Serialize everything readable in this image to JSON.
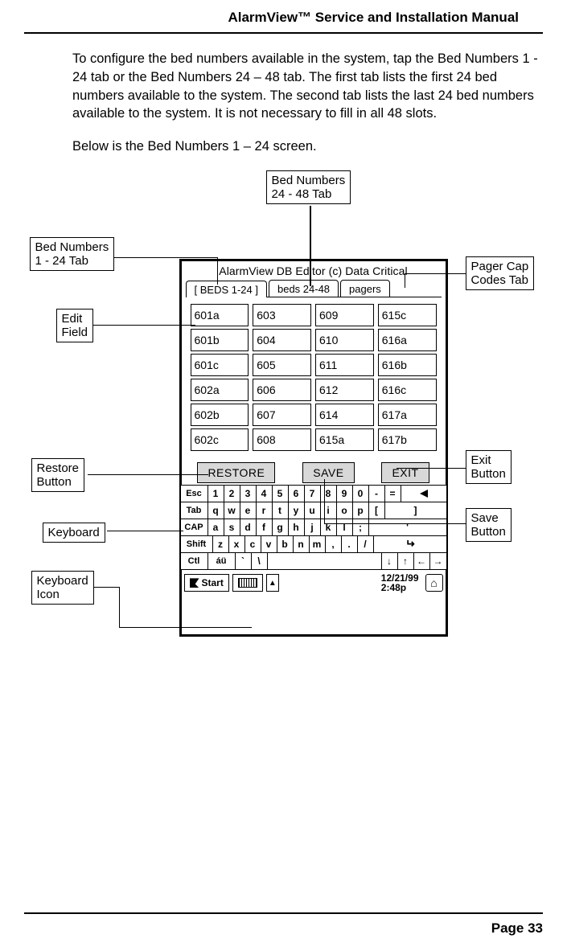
{
  "header": {
    "title": "AlarmView™ Service and Installation Manual"
  },
  "text": {
    "p1": "To configure the bed numbers available in the system, tap the Bed Numbers 1 - 24 tab or the Bed Numbers 24 – 48 tab.  The first tab lists the first 24 bed numbers available to the system.  The second tab lists the last 24 bed numbers available to the system.  It is not necessary to fill in all 48 slots.",
    "p2": "Below is the Bed Numbers 1 – 24 screen."
  },
  "callouts": {
    "bed_24_48": "Bed Numbers\n24 - 48 Tab",
    "bed_1_24": "Bed Numbers\n1 - 24 Tab",
    "pager_cap": "Pager Cap\nCodes Tab",
    "edit_field": "Edit\nField",
    "restore_btn": "Restore\nButton",
    "keyboard": "Keyboard",
    "keyboard_icon": "Keyboard\nIcon",
    "exit_btn": "Exit\nButton",
    "save_btn": "Save\nButton"
  },
  "device": {
    "title": "AlarmView DB Editor (c) Data Critical",
    "tabs": {
      "t1": "[ BEDS 1-24 ]",
      "t2": "beds 24-48",
      "t3": "pagers"
    },
    "cells": [
      "601a",
      "603",
      "609",
      "615c",
      "601b",
      "604",
      "610",
      "616a",
      "601c",
      "605",
      "611",
      "616b",
      "602a",
      "606",
      "612",
      "616c",
      "602b",
      "607",
      "614",
      "617a",
      "602c",
      "608",
      "615a",
      "617b"
    ],
    "buttons": {
      "restore": "RESTORE",
      "save": "SAVE",
      "exit": "EXIT"
    }
  },
  "keyboard": {
    "row1": [
      "Esc",
      "1",
      "2",
      "3",
      "4",
      "5",
      "6",
      "7",
      "8",
      "9",
      "0",
      "-",
      "="
    ],
    "row2": [
      "Tab",
      "q",
      "w",
      "e",
      "r",
      "t",
      "y",
      "u",
      "i",
      "o",
      "p",
      "[",
      "]"
    ],
    "row3": [
      "CAP",
      "a",
      "s",
      "d",
      "f",
      "g",
      "h",
      "j",
      "k",
      "l",
      ";",
      "'"
    ],
    "row4": [
      "Shift",
      "z",
      "x",
      "c",
      "v",
      "b",
      "n",
      "m",
      ",",
      ".",
      "/"
    ],
    "row5": [
      "Ctl",
      "áü",
      "`",
      "\\"
    ],
    "arrows": [
      "↓",
      "↑",
      "←",
      "→"
    ]
  },
  "taskbar": {
    "start": "Start",
    "date": "12/21/99",
    "time": "2:48p"
  },
  "footer": {
    "page": "Page 33"
  }
}
